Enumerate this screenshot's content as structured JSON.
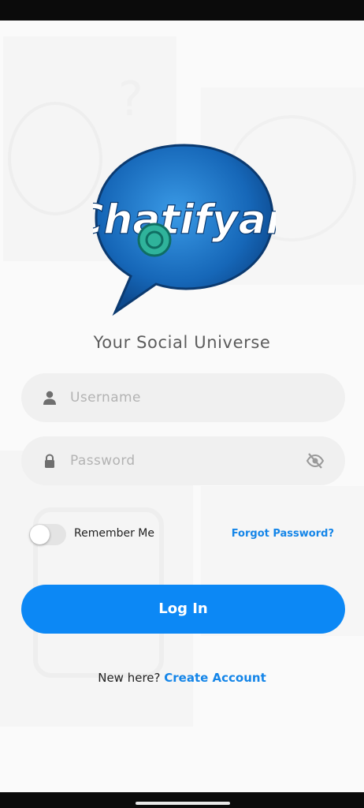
{
  "app": {
    "logo_text": "Chatifyan",
    "tagline": "Your Social Universe"
  },
  "login_form": {
    "username": {
      "placeholder": "Username",
      "value": "",
      "icon": "person-icon"
    },
    "password": {
      "placeholder": "Password",
      "value": "",
      "icon": "lock-icon",
      "toggle_icon": "eye-off-icon"
    },
    "remember_me": {
      "label": "Remember Me",
      "checked": false
    },
    "forgot_password_label": "Forgot Password?",
    "submit_label": "Log In"
  },
  "signup": {
    "prompt": "New here?",
    "link_label": "Create Account"
  },
  "colors": {
    "accent": "#0c88f5",
    "link": "#1485e8",
    "field_bg": "#f0f0f0",
    "logo_blue": "#1667b8"
  }
}
